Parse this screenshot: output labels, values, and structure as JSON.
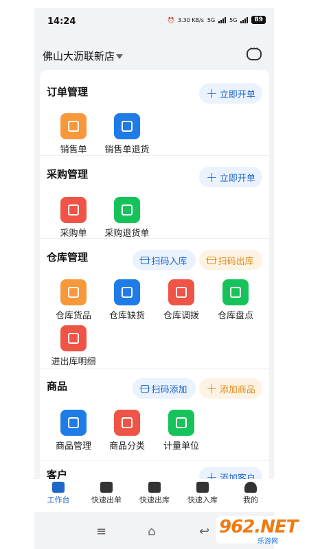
{
  "status_bar": {
    "time": "14:24",
    "net_speed": "3.30 KB/s",
    "sim1": "5G",
    "sim2": "5G",
    "battery": "89"
  },
  "header": {
    "store_name": "佛山大沥联新店",
    "chat_icon": "chat-icon"
  },
  "sections": {
    "order": {
      "title": "订单管理",
      "action": "立即开单",
      "items": [
        {
          "label": "销售单",
          "icon": "receipt-icon",
          "color": "#f7983b"
        },
        {
          "label": "销售单退货",
          "icon": "return-icon",
          "color": "#1f7be6"
        }
      ]
    },
    "purchase": {
      "title": "采购管理",
      "action": "立即开单",
      "items": [
        {
          "label": "采购单",
          "icon": "bag-icon",
          "color": "#f05446"
        },
        {
          "label": "采购退货单",
          "icon": "return-bag-icon",
          "color": "#16c35b"
        }
      ]
    },
    "warehouse": {
      "title": "仓库管理",
      "action_in": "扫码入库",
      "action_out": "扫码出库",
      "items": [
        {
          "label": "仓库货品",
          "icon": "boxes-icon",
          "color": "#f7983b"
        },
        {
          "label": "仓库缺货",
          "icon": "box-alert-icon",
          "color": "#1f7be6"
        },
        {
          "label": "仓库调拨",
          "icon": "transfer-icon",
          "color": "#f05446"
        },
        {
          "label": "仓库盘点",
          "icon": "inventory-icon",
          "color": "#16c35b"
        },
        {
          "label": "进出库明细",
          "icon": "ledger-icon",
          "color": "#f05446"
        }
      ]
    },
    "goods": {
      "title": "商品",
      "action_scan": "扫码添加",
      "action_add": "添加商品",
      "items": [
        {
          "label": "商品管理",
          "icon": "bookmark-icon",
          "color": "#1f7be6"
        },
        {
          "label": "商品分类",
          "icon": "category-icon",
          "color": "#f05446"
        },
        {
          "label": "计量单位",
          "icon": "scale-icon",
          "color": "#16c35b"
        }
      ]
    },
    "customer": {
      "title": "客户",
      "action": "添加客户"
    }
  },
  "tabbar": [
    {
      "label": "工作台",
      "icon": "dashboard-icon",
      "active": true
    },
    {
      "label": "快速出单",
      "icon": "trend-icon",
      "active": false
    },
    {
      "label": "快速出库",
      "icon": "wallet-icon",
      "active": false
    },
    {
      "label": "快速入库",
      "icon": "warehouse-icon",
      "active": false
    },
    {
      "label": "我的",
      "icon": "user-icon",
      "active": false
    }
  ],
  "watermark": {
    "main": "962.NET",
    "sub": "乐游网"
  },
  "colors": {
    "accent_blue": "#1f67c9",
    "accent_orange": "#e08a1a"
  }
}
